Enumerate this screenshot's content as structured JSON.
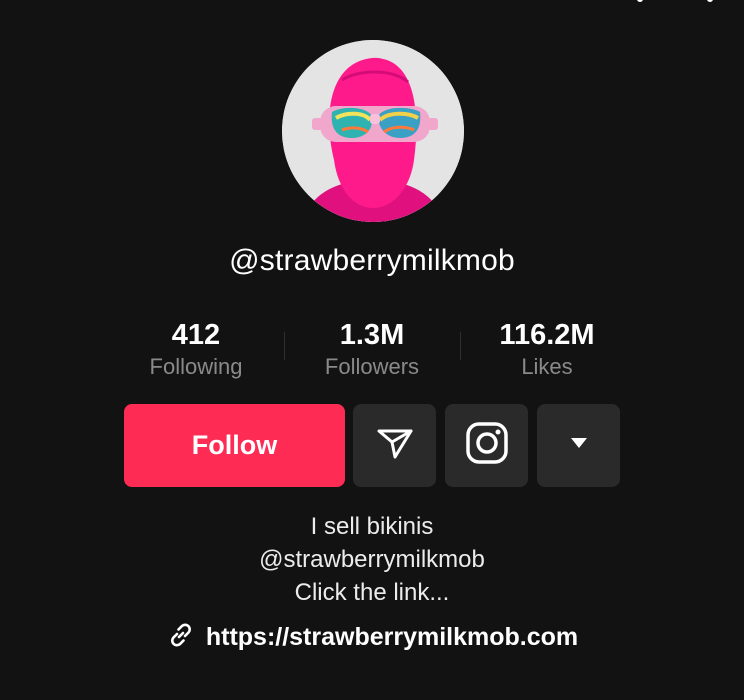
{
  "profile": {
    "username": "@strawberrymilkmob",
    "stats": [
      {
        "value": "412",
        "label": "Following"
      },
      {
        "value": "1.3M",
        "label": "Followers"
      },
      {
        "value": "116.2M",
        "label": "Likes"
      }
    ],
    "actions": {
      "follow_label": "Follow",
      "send_icon": "paper-plane-icon",
      "instagram_icon": "instagram-icon",
      "more_icon": "caret-down-icon"
    },
    "bio": [
      "I sell bikinis",
      "@strawberrymilkmob",
      "Click the link..."
    ],
    "link": {
      "icon": "link-icon",
      "url": "https://strawberrymilkmob.com"
    }
  },
  "colors": {
    "background": "#121212",
    "follow_button": "#fe2c55",
    "secondary_button": "#2a2a2a",
    "muted_text": "#8a8a8a"
  }
}
